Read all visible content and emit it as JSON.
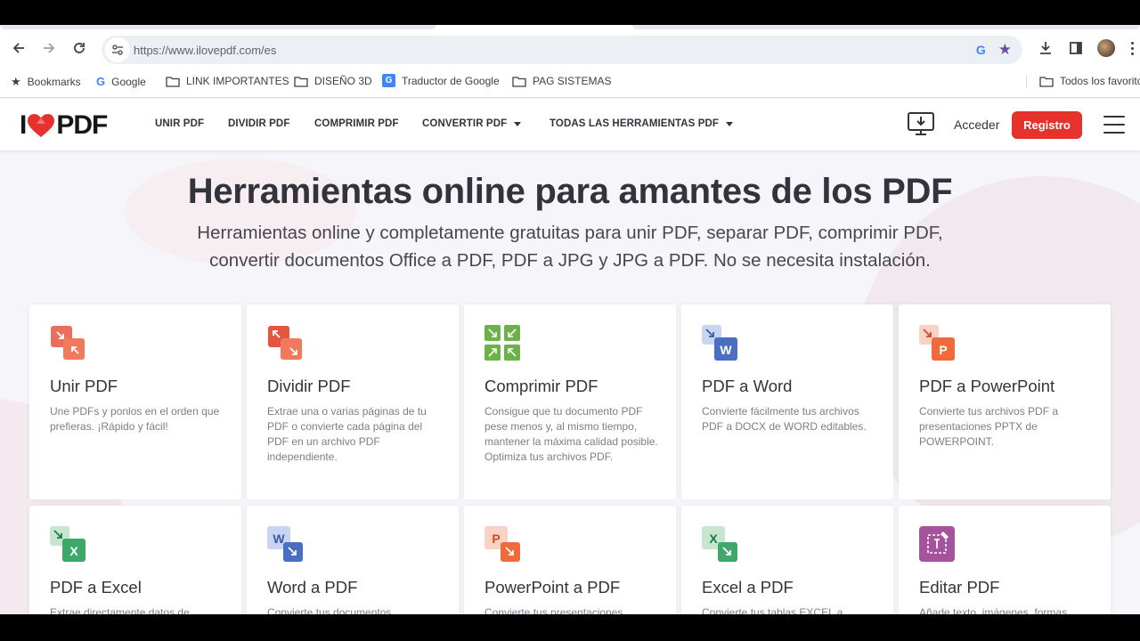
{
  "browser": {
    "url": "https://www.ilovepdf.com/es",
    "bookmarks": [
      {
        "label": "Bookmarks",
        "icon": "star-icon"
      },
      {
        "label": "Google",
        "icon": "google-icon"
      },
      {
        "label": "LINK IMPORTANTES",
        "icon": "folder-icon"
      },
      {
        "label": "DISEÑO 3D",
        "icon": "folder-icon"
      },
      {
        "label": "Traductor de Google",
        "icon": "translate-icon"
      },
      {
        "label": "PAG SISTEMAS",
        "icon": "folder-icon"
      }
    ],
    "other_bookmarks": "Todos los favoritos"
  },
  "site": {
    "logo_left": "I",
    "logo_right": "PDF",
    "menu": [
      {
        "label": "UNIR PDF"
      },
      {
        "label": "DIVIDIR PDF"
      },
      {
        "label": "COMPRIMIR PDF"
      },
      {
        "label": "CONVERTIR PDF"
      },
      {
        "label": "TODAS LAS HERRAMIENTAS PDF"
      }
    ],
    "login": "Acceder",
    "register": "Registro"
  },
  "hero": {
    "title": "Herramientas online para amantes de los PDF",
    "subtitle_line1": "Herramientas online y completamente gratuitas para unir PDF, separar PDF, comprimir PDF,",
    "subtitle_line2": "convertir documentos Office a PDF, PDF a JPG y JPG a PDF. No se necesita instalación."
  },
  "tools": [
    {
      "title": "Unir PDF",
      "desc": "Une PDFs y ponlos en el orden que prefieras. ¡Rápido y fácil!",
      "icon": "merge-icon"
    },
    {
      "title": "Dividir PDF",
      "desc": "Extrae una o varias páginas de tu PDF o convierte cada página del PDF en un archivo PDF independiente.",
      "icon": "split-icon"
    },
    {
      "title": "Comprimir PDF",
      "desc": "Consigue que tu documento PDF pese menos y, al mismo tiempo, mantener la máxima calidad posible. Optimiza tus archivos PDF.",
      "icon": "compress-icon"
    },
    {
      "title": "PDF a Word",
      "desc": "Convierte fácilmente tus archivos PDF a DOCX de WORD editables.",
      "icon": "pdf-to-word-icon"
    },
    {
      "title": "PDF a PowerPoint",
      "desc": "Convierte tus archivos PDF a presentaciones PPTX de POWERPOINT.",
      "icon": "pdf-to-powerpoint-icon"
    },
    {
      "title": "PDF a Excel",
      "desc": "Extrae directamente datos de",
      "icon": "pdf-to-excel-icon"
    },
    {
      "title": "Word a PDF",
      "desc": "Convierte tus documentos",
      "icon": "word-to-pdf-icon"
    },
    {
      "title": "PowerPoint a PDF",
      "desc": "Convierte tus presentaciones",
      "icon": "powerpoint-to-pdf-icon"
    },
    {
      "title": "Excel a PDF",
      "desc": "Convierte tus tablas EXCEL a",
      "icon": "excel-to-pdf-icon"
    },
    {
      "title": "Editar PDF",
      "desc": "Añade texto, imágenes, formas",
      "icon": "edit-pdf-icon"
    }
  ],
  "colors": {
    "brand_red": "#e5322d",
    "text_dark": "#33333b",
    "page_bg": "#f5f5fa"
  }
}
